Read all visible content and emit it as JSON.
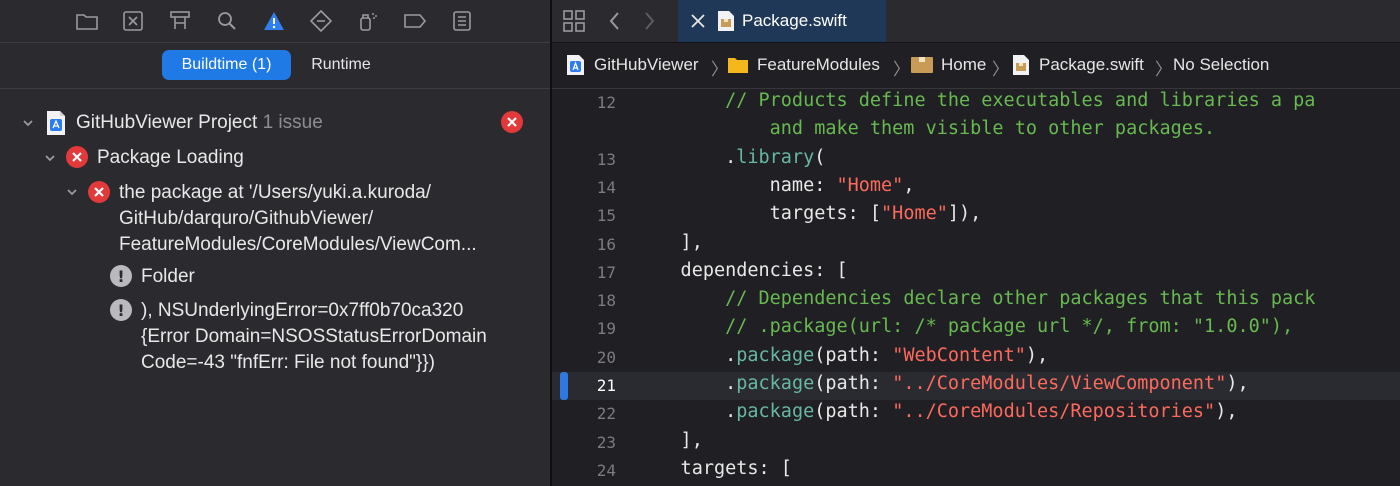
{
  "navigator": {
    "toolbar_icons": [
      "folder-icon",
      "source-control-icon",
      "hierarchy-icon",
      "search-icon",
      "issue-warning-icon",
      "test-diamond-icon",
      "debug-spray-icon",
      "breakpoint-icon",
      "report-icon"
    ],
    "segments": {
      "buildtime": "Buildtime (1)",
      "runtime": "Runtime"
    },
    "project": {
      "name": "GitHubViewer Project",
      "issue_count": "1 issue"
    },
    "group": {
      "label": "Package Loading"
    },
    "error": {
      "line1": "the package at '/Users/yuki.a.kuroda/",
      "line2": "GitHub/darquro/GithubViewer/",
      "line3": "FeatureModules/CoreModules/ViewCom..."
    },
    "notes": [
      {
        "line1": "Folder"
      },
      {
        "line1": "), NSUnderlyingError=0x7ff0b70ca320",
        "line2": "{Error Domain=NSOSStatusErrorDomain",
        "line3": "Code=-43 \"fnfErr: File not found\"}})"
      }
    ],
    "colors": {
      "accent": "#1f7ae6",
      "error": "#e23a3a"
    }
  },
  "editor": {
    "tab": {
      "title": "Package.swift"
    },
    "jumpbar": [
      "GitHubViewer",
      "FeatureModules",
      "Home",
      "Package.swift",
      "No Selection"
    ],
    "current_line": "21",
    "lines": [
      {
        "n": "12",
        "parts": [
          {
            "t": "        "
          },
          {
            "t": "// Products define the executables and libraries a pa",
            "k": "com"
          }
        ]
      },
      {
        "n": "",
        "parts": [
          {
            "t": "            "
          },
          {
            "t": "and make them visible to other packages.",
            "k": "com"
          }
        ]
      },
      {
        "n": "13",
        "parts": [
          {
            "t": "        ."
          },
          {
            "t": "library",
            "k": "fn"
          },
          {
            "t": "("
          }
        ]
      },
      {
        "n": "14",
        "parts": [
          {
            "t": "            name: "
          },
          {
            "t": "\"Home\"",
            "k": "str"
          },
          {
            "t": ","
          }
        ]
      },
      {
        "n": "15",
        "parts": [
          {
            "t": "            targets: ["
          },
          {
            "t": "\"Home\"",
            "k": "str"
          },
          {
            "t": "]),"
          }
        ]
      },
      {
        "n": "16",
        "parts": [
          {
            "t": "    ],"
          }
        ]
      },
      {
        "n": "17",
        "parts": [
          {
            "t": "    dependencies: ["
          }
        ]
      },
      {
        "n": "18",
        "parts": [
          {
            "t": "        "
          },
          {
            "t": "// Dependencies declare other packages that this pack",
            "k": "com"
          }
        ]
      },
      {
        "n": "19",
        "parts": [
          {
            "t": "        "
          },
          {
            "t": "// .package(url: /* package url */, from: \"1.0.0\"),",
            "k": "com"
          }
        ]
      },
      {
        "n": "20",
        "parts": [
          {
            "t": "        ."
          },
          {
            "t": "package",
            "k": "fn"
          },
          {
            "t": "(path: "
          },
          {
            "t": "\"WebContent\"",
            "k": "str"
          },
          {
            "t": "),"
          }
        ]
      },
      {
        "n": "21",
        "parts": [
          {
            "t": "        ."
          },
          {
            "t": "package",
            "k": "fn"
          },
          {
            "t": "(path: "
          },
          {
            "t": "\"../CoreModules/ViewComponent\"",
            "k": "str"
          },
          {
            "t": "),"
          }
        ]
      },
      {
        "n": "22",
        "parts": [
          {
            "t": "        ."
          },
          {
            "t": "package",
            "k": "fn"
          },
          {
            "t": "(path: "
          },
          {
            "t": "\"../CoreModules/Repositories\"",
            "k": "str"
          },
          {
            "t": "),"
          }
        ]
      },
      {
        "n": "23",
        "parts": [
          {
            "t": "    ],"
          }
        ]
      },
      {
        "n": "24",
        "parts": [
          {
            "t": "    targets: ["
          }
        ]
      }
    ]
  }
}
